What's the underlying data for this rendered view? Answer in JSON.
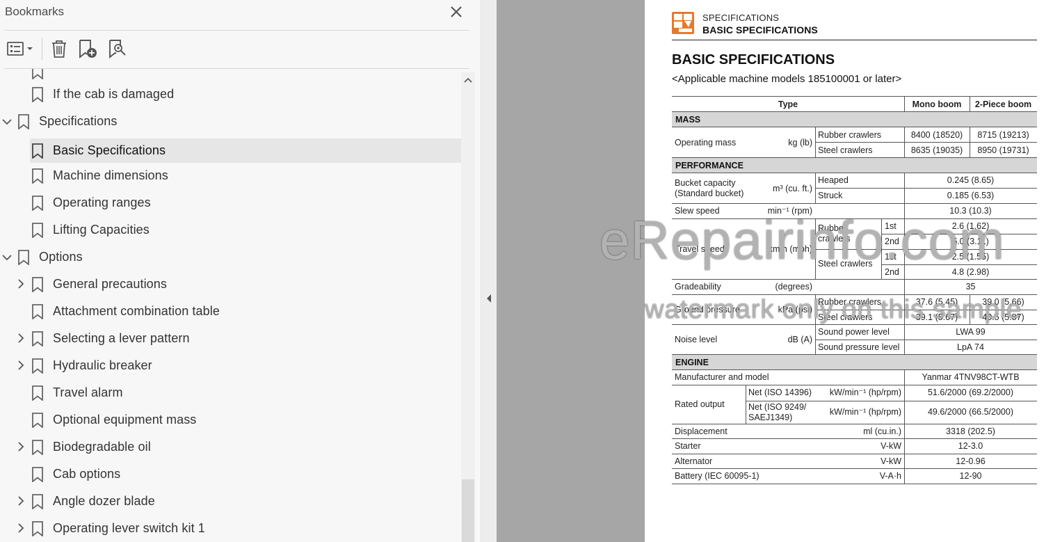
{
  "bookmarks_panel": {
    "title": "Bookmarks",
    "toolbar": {
      "options_icon": "list-options-icon",
      "delete_icon": "trash-icon",
      "new_bookmark_icon": "bookmark-add-icon",
      "find_bookmark_icon": "bookmark-search-icon"
    },
    "items": [
      {
        "label": "If the cab is damaged"
      },
      {
        "label": "Specifications"
      },
      {
        "label": "Basic Specifications"
      },
      {
        "label": "Machine dimensions"
      },
      {
        "label": "Operating ranges"
      },
      {
        "label": "Lifting Capacities"
      },
      {
        "label": "Options"
      },
      {
        "label": "General precautions"
      },
      {
        "label": "Attachment combination table"
      },
      {
        "label": "Selecting a lever pattern"
      },
      {
        "label": "Hydraulic breaker"
      },
      {
        "label": "Travel alarm"
      },
      {
        "label": "Optional equipment mass"
      },
      {
        "label": "Biodegradable oil"
      },
      {
        "label": "Cab options"
      },
      {
        "label": "Angle dozer blade"
      },
      {
        "label": "Operating lever switch kit 1"
      }
    ]
  },
  "document": {
    "header_section": "SPECIFICATIONS",
    "header_subsection": "BASIC SPECIFICATIONS",
    "title": "BASIC SPECIFICATIONS",
    "subtitle": "<Applicable machine models 185100001 or later>",
    "table": {
      "col_type": "Type",
      "col_mono": "Mono boom",
      "col_2piece": "2-Piece boom",
      "mass": {
        "section": "MASS",
        "label": "Operating mass",
        "unit": "kg (lb)",
        "rubber": "Rubber crawlers",
        "steel": "Steel crawlers",
        "rubber_mono": "8400 (18520)",
        "rubber_2p": "8715 (19213)",
        "steel_mono": "8635 (19035)",
        "steel_2p": "8950 (19731)"
      },
      "performance": {
        "section": "PERFORMANCE",
        "bucket_label1": "Bucket capacity",
        "bucket_label2": "(Standard bucket)",
        "bucket_unit": "m³ (cu. ft.)",
        "heaped": "Heaped",
        "struck": "Struck",
        "heaped_val": "0.245 (8.65)",
        "struck_val": "0.185 (6.53)",
        "slew_label": "Slew speed",
        "slew_unit": "min⁻¹ (rpm)",
        "slew_val": "10.3 (10.3)",
        "travel_label": "Travel speed",
        "travel_unit": "km/h (mph)",
        "rubber_crawlers_1": "Rubber",
        "rubber_crawlers_2": "crawlers",
        "steel_crawlers": "Steel crawlers",
        "first": "1st",
        "second": "2nd",
        "rubber_1st": "2.6 (1.62)",
        "rubber_2nd": "5.0 (3.11)",
        "steel_1st": "2.5 (1.55)",
        "steel_2nd": "4.8 (2.98)",
        "grade_label": "Gradeability",
        "grade_unit": "(degrees)",
        "grade_val": "35",
        "ground_label": "Ground pressure",
        "ground_unit": "kPa (psi)",
        "ground_rubber": "Rubber crawlers",
        "ground_steel": "Steel crawlers",
        "ground_rubber_mono": "37.6 (5.45)",
        "ground_rubber_2p": "39.0 (5.66)",
        "ground_steel_mono": "39.1 (5.67)",
        "ground_steel_2p": "40.5 (5.87)",
        "noise_label": "Noise level",
        "noise_unit": "dB (A)",
        "sound_power": "Sound power level",
        "sound_pressure": "Sound pressure level",
        "sound_power_val": "LWA 99",
        "sound_pressure_val": "LpA 74"
      },
      "engine": {
        "section": "ENGINE",
        "manufacturer_label": "Manufacturer and model",
        "manufacturer_val": "Yanmar 4TNV98CT-WTB",
        "rated_label": "Rated output",
        "net_iso14396": "Net (ISO 14396)",
        "net_iso9249_1": "Net (ISO 9249/",
        "net_iso9249_2": "SAEJ1349)",
        "rated_unit": "kW/min⁻¹ (hp/rpm)",
        "rated_val1": "51.6/2000 (69.2/2000)",
        "rated_val2": "49.6/2000 (66.5/2000)",
        "displacement_label": "Displacement",
        "displacement_unit": "ml (cu.in.)",
        "displacement_val": "3318 (202.5)",
        "starter_label": "Starter",
        "starter_unit": "V-kW",
        "starter_val": "12-3.0",
        "alternator_label": "Alternator",
        "alternator_unit": "V-kW",
        "alternator_val": "12-0.96",
        "battery_label": "Battery (IEC 60095-1)",
        "battery_unit": "V-A·h",
        "battery_val": "12-90"
      }
    }
  },
  "watermark": {
    "line1": "eRepairinfo.com",
    "line2": "watermark only on this sample"
  },
  "colors": {
    "panel_bg": "#f7f7f7",
    "selected_bg": "#e6e6e6",
    "gray_area": "#a6a6a6",
    "section_band": "#d6d6d6",
    "header_icon": "#e8792b"
  }
}
